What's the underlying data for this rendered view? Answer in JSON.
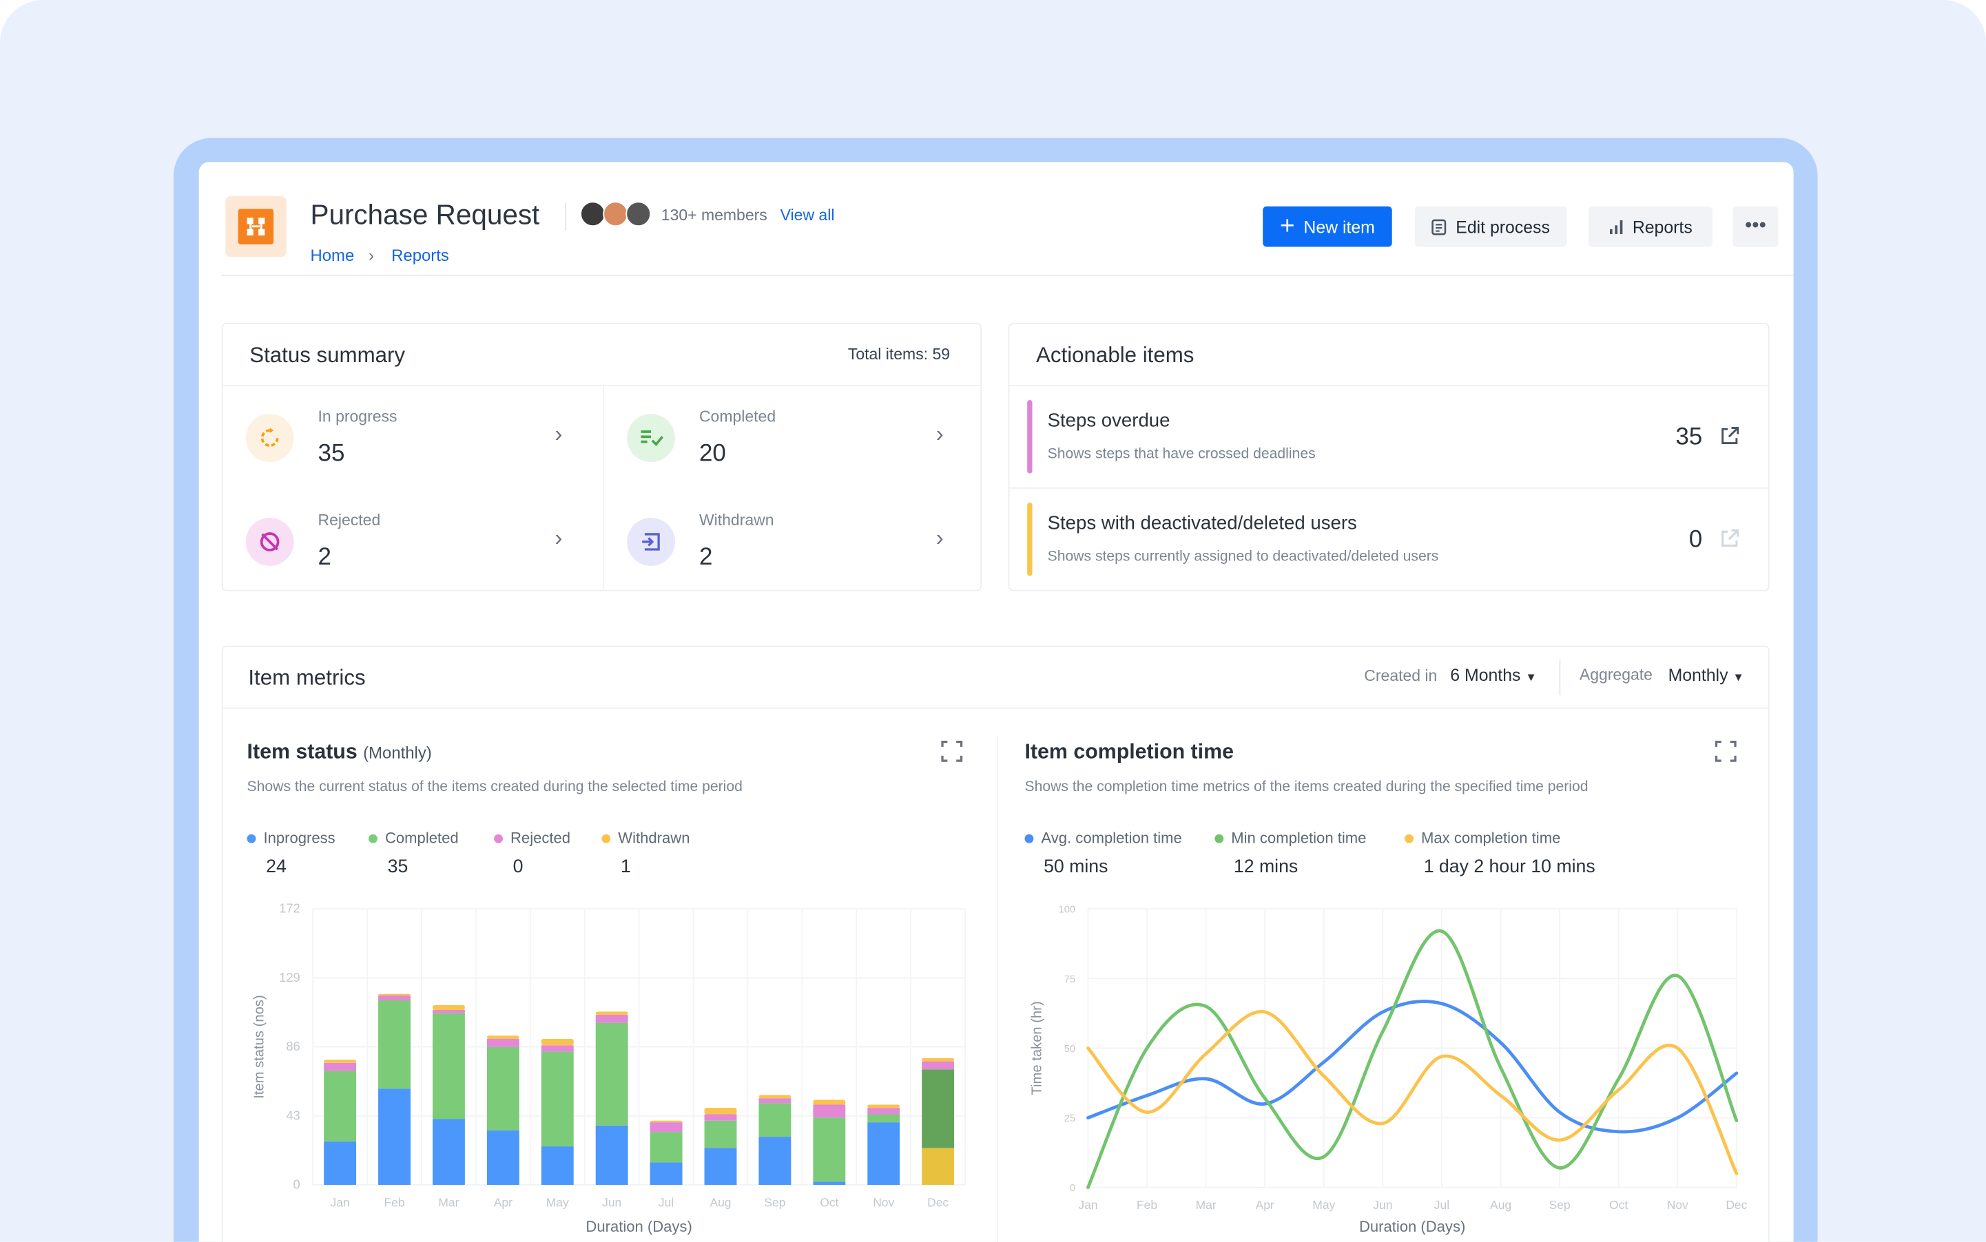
{
  "header": {
    "title": "Purchase Request",
    "breadcrumb": [
      "Home",
      "Reports"
    ],
    "members": "130+ members",
    "view_all": "View all",
    "buttons": {
      "new_item": "New item",
      "edit_process": "Edit process",
      "reports": "Reports"
    }
  },
  "colors": {
    "accent": "#0b6cf6",
    "inprogress": "#4b97fb",
    "completed": "#7ccb78",
    "rejected": "#e387d6",
    "withdrawn": "#fbc34d"
  },
  "status_summary": {
    "title": "Status summary",
    "total": "Total items: 59",
    "items": [
      {
        "label": "In progress",
        "value": "35",
        "icon": "refresh-icon"
      },
      {
        "label": "Completed",
        "value": "20",
        "icon": "list-check-icon"
      },
      {
        "label": "Rejected",
        "value": "2",
        "icon": "rejected-icon"
      },
      {
        "label": "Withdrawn",
        "value": "2",
        "icon": "withdraw-icon"
      }
    ]
  },
  "actionable": {
    "title": "Actionable items",
    "items": [
      {
        "title": "Steps overdue",
        "desc": "Shows steps that have crossed deadlines",
        "value": "35",
        "accent": "#dc86d6"
      },
      {
        "title": "Steps with deactivated/deleted users",
        "desc": "Shows steps currently assigned to deactivated/deleted users",
        "value": "0",
        "accent": "#f7c64b"
      }
    ]
  },
  "metrics": {
    "title": "Item metrics",
    "created_in_label": "Created in",
    "created_in_value": "6 Months",
    "aggregate_label": "Aggregate",
    "aggregate_value": "Monthly"
  },
  "chart_data": [
    {
      "type": "bar",
      "stacked": true,
      "title": "Item status",
      "title_suffix": "(Monthly)",
      "subtitle": "Shows the current status of the items created during the selected time period",
      "xlabel": "Duration (Days)",
      "ylabel": "Item status (nos)",
      "ylim": [
        0,
        172
      ],
      "yticks": [
        "0",
        "43",
        "86",
        "129",
        "172"
      ],
      "grid": true,
      "categories": [
        "Jan",
        "Feb",
        "Mar",
        "Apr",
        "May",
        "Jun",
        "Jul",
        "Aug",
        "Sep",
        "Oct",
        "Nov",
        "Dec"
      ],
      "highlighted": "Dec",
      "series": [
        {
          "name": "Inprogress",
          "total": "24",
          "color": "#4b97fb",
          "values": [
            27,
            60,
            41,
            34,
            24,
            37,
            14,
            23,
            30,
            2,
            39,
            23
          ]
        },
        {
          "name": "Completed",
          "total": "35",
          "color": "#7ccb78",
          "values": [
            44,
            55,
            66,
            52,
            59,
            64,
            19,
            17,
            21,
            40,
            5,
            49
          ]
        },
        {
          "name": "Rejected",
          "total": "0",
          "color": "#e387d6",
          "values": [
            5,
            3,
            2,
            5,
            4,
            5,
            6,
            4,
            3,
            8,
            4,
            5
          ]
        },
        {
          "name": "Withdrawn",
          "total": "1",
          "color": "#fbc34d",
          "values": [
            2,
            1,
            3,
            2,
            4,
            2,
            1,
            4,
            2,
            3,
            2,
            2
          ]
        }
      ]
    },
    {
      "type": "line",
      "smooth": true,
      "title": "Item completion time",
      "subtitle": "Shows the completion time metrics of the items created during the specified time period",
      "xlabel": "Duration (Days)",
      "ylabel": "Time taken (hr)",
      "ylim": [
        0,
        100
      ],
      "yticks": [
        "0",
        "25",
        "50",
        "75",
        "100"
      ],
      "grid": true,
      "categories": [
        "Jan",
        "Feb",
        "Mar",
        "Apr",
        "May",
        "Jun",
        "Jul",
        "Aug",
        "Sep",
        "Oct",
        "Nov",
        "Dec"
      ],
      "series": [
        {
          "name": "Avg. completion time",
          "total": "50 mins",
          "color": "#4b8ef5",
          "values": [
            25,
            33,
            39,
            30,
            45,
            63,
            66,
            52,
            27,
            20,
            25,
            41
          ]
        },
        {
          "name": "Min completion time",
          "total": "12 mins",
          "color": "#72c46c",
          "values": [
            0,
            50,
            65,
            32,
            11,
            56,
            92,
            43,
            7,
            39,
            76,
            24
          ]
        },
        {
          "name": "Max completion time",
          "total": "1 day 2 hour 10 mins",
          "color": "#fbc34d",
          "values": [
            50,
            27,
            48,
            63,
            40,
            23,
            47,
            33,
            17,
            35,
            50,
            5
          ]
        }
      ]
    }
  ]
}
